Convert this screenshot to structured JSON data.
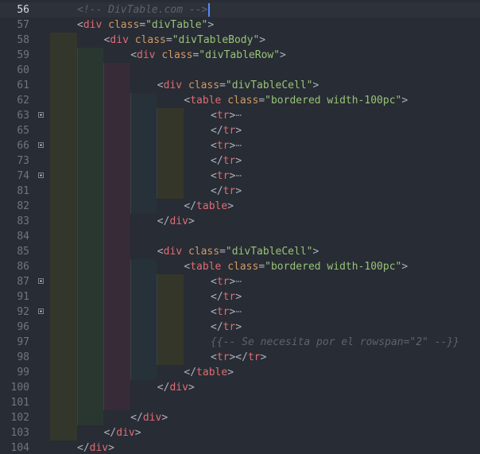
{
  "editor": {
    "active_line": "56",
    "lines": [
      {
        "n": "56",
        "ind": 0,
        "fold": false,
        "tokens": [
          {
            "t": "comment",
            "v": "<!-- DivTable.com -->"
          }
        ]
      },
      {
        "n": "57",
        "ind": 0,
        "fold": false,
        "tokens": [
          {
            "t": "punct",
            "v": "<"
          },
          {
            "t": "tag",
            "v": "div"
          },
          {
            "t": "punct",
            "v": " "
          },
          {
            "t": "attr",
            "v": "class"
          },
          {
            "t": "punct",
            "v": "="
          },
          {
            "t": "str",
            "v": "\"divTable\""
          },
          {
            "t": "punct",
            "v": ">"
          }
        ]
      },
      {
        "n": "58",
        "ind": 1,
        "fold": false,
        "tokens": [
          {
            "t": "punct",
            "v": "<"
          },
          {
            "t": "tag",
            "v": "div"
          },
          {
            "t": "punct",
            "v": " "
          },
          {
            "t": "attr",
            "v": "class"
          },
          {
            "t": "punct",
            "v": "="
          },
          {
            "t": "str",
            "v": "\"divTableBody\""
          },
          {
            "t": "punct",
            "v": ">"
          }
        ]
      },
      {
        "n": "59",
        "ind": 2,
        "fold": false,
        "tokens": [
          {
            "t": "punct",
            "v": "<"
          },
          {
            "t": "tag",
            "v": "div"
          },
          {
            "t": "punct",
            "v": " "
          },
          {
            "t": "attr",
            "v": "class"
          },
          {
            "t": "punct",
            "v": "="
          },
          {
            "t": "str",
            "v": "\"divTableRow\""
          },
          {
            "t": "punct",
            "v": ">"
          }
        ]
      },
      {
        "n": "60",
        "ind": 3,
        "fold": false,
        "tokens": []
      },
      {
        "n": "61",
        "ind": 3,
        "fold": false,
        "tokens": [
          {
            "t": "punct",
            "v": "<"
          },
          {
            "t": "tag",
            "v": "div"
          },
          {
            "t": "punct",
            "v": " "
          },
          {
            "t": "attr",
            "v": "class"
          },
          {
            "t": "punct",
            "v": "="
          },
          {
            "t": "str",
            "v": "\"divTableCell\""
          },
          {
            "t": "punct",
            "v": ">"
          }
        ]
      },
      {
        "n": "62",
        "ind": 4,
        "fold": false,
        "tokens": [
          {
            "t": "punct",
            "v": "<"
          },
          {
            "t": "tag",
            "v": "table"
          },
          {
            "t": "punct",
            "v": " "
          },
          {
            "t": "attr",
            "v": "class"
          },
          {
            "t": "punct",
            "v": "="
          },
          {
            "t": "str",
            "v": "\"bordered width-100pc\""
          },
          {
            "t": "punct",
            "v": ">"
          }
        ]
      },
      {
        "n": "63",
        "ind": 5,
        "fold": true,
        "tokens": [
          {
            "t": "punct",
            "v": "<"
          },
          {
            "t": "tag",
            "v": "tr"
          },
          {
            "t": "punct",
            "v": ">"
          },
          {
            "t": "ellipsis",
            "v": "⋯"
          }
        ]
      },
      {
        "n": "65",
        "ind": 5,
        "fold": false,
        "tokens": [
          {
            "t": "punct",
            "v": "</"
          },
          {
            "t": "tag",
            "v": "tr"
          },
          {
            "t": "punct",
            "v": ">"
          }
        ]
      },
      {
        "n": "66",
        "ind": 5,
        "fold": true,
        "tokens": [
          {
            "t": "punct",
            "v": "<"
          },
          {
            "t": "tag",
            "v": "tr"
          },
          {
            "t": "punct",
            "v": ">"
          },
          {
            "t": "ellipsis",
            "v": "⋯"
          }
        ]
      },
      {
        "n": "73",
        "ind": 5,
        "fold": false,
        "tokens": [
          {
            "t": "punct",
            "v": "</"
          },
          {
            "t": "tag",
            "v": "tr"
          },
          {
            "t": "punct",
            "v": ">"
          }
        ]
      },
      {
        "n": "74",
        "ind": 5,
        "fold": true,
        "tokens": [
          {
            "t": "punct",
            "v": "<"
          },
          {
            "t": "tag",
            "v": "tr"
          },
          {
            "t": "punct",
            "v": ">"
          },
          {
            "t": "ellipsis",
            "v": "⋯"
          }
        ]
      },
      {
        "n": "81",
        "ind": 5,
        "fold": false,
        "tokens": [
          {
            "t": "punct",
            "v": "</"
          },
          {
            "t": "tag",
            "v": "tr"
          },
          {
            "t": "punct",
            "v": ">"
          }
        ]
      },
      {
        "n": "82",
        "ind": 4,
        "fold": false,
        "tokens": [
          {
            "t": "punct",
            "v": "</"
          },
          {
            "t": "tag",
            "v": "table"
          },
          {
            "t": "punct",
            "v": ">"
          }
        ]
      },
      {
        "n": "83",
        "ind": 3,
        "fold": false,
        "tokens": [
          {
            "t": "punct",
            "v": "</"
          },
          {
            "t": "tag",
            "v": "div"
          },
          {
            "t": "punct",
            "v": ">"
          }
        ]
      },
      {
        "n": "84",
        "ind": 3,
        "fold": false,
        "tokens": []
      },
      {
        "n": "85",
        "ind": 3,
        "fold": false,
        "tokens": [
          {
            "t": "punct",
            "v": "<"
          },
          {
            "t": "tag",
            "v": "div"
          },
          {
            "t": "punct",
            "v": " "
          },
          {
            "t": "attr",
            "v": "class"
          },
          {
            "t": "punct",
            "v": "="
          },
          {
            "t": "str",
            "v": "\"divTableCell\""
          },
          {
            "t": "punct",
            "v": ">"
          }
        ]
      },
      {
        "n": "86",
        "ind": 4,
        "fold": false,
        "tokens": [
          {
            "t": "punct",
            "v": "<"
          },
          {
            "t": "tag",
            "v": "table"
          },
          {
            "t": "punct",
            "v": " "
          },
          {
            "t": "attr",
            "v": "class"
          },
          {
            "t": "punct",
            "v": "="
          },
          {
            "t": "str",
            "v": "\"bordered width-100pc\""
          },
          {
            "t": "punct",
            "v": ">"
          }
        ]
      },
      {
        "n": "87",
        "ind": 5,
        "fold": true,
        "tokens": [
          {
            "t": "punct",
            "v": "<"
          },
          {
            "t": "tag",
            "v": "tr"
          },
          {
            "t": "punct",
            "v": ">"
          },
          {
            "t": "ellipsis",
            "v": "⋯"
          }
        ]
      },
      {
        "n": "91",
        "ind": 5,
        "fold": false,
        "tokens": [
          {
            "t": "punct",
            "v": "</"
          },
          {
            "t": "tag",
            "v": "tr"
          },
          {
            "t": "punct",
            "v": ">"
          }
        ]
      },
      {
        "n": "92",
        "ind": 5,
        "fold": true,
        "tokens": [
          {
            "t": "punct",
            "v": "<"
          },
          {
            "t": "tag",
            "v": "tr"
          },
          {
            "t": "punct",
            "v": ">"
          },
          {
            "t": "ellipsis",
            "v": "⋯"
          }
        ]
      },
      {
        "n": "96",
        "ind": 5,
        "fold": false,
        "tokens": [
          {
            "t": "punct",
            "v": "</"
          },
          {
            "t": "tag",
            "v": "tr"
          },
          {
            "t": "punct",
            "v": ">"
          }
        ]
      },
      {
        "n": "97",
        "ind": 5,
        "fold": false,
        "tokens": [
          {
            "t": "comment",
            "v": "{{-- Se necesita por el rowspan=\"2\" --}}"
          }
        ]
      },
      {
        "n": "98",
        "ind": 5,
        "fold": false,
        "tokens": [
          {
            "t": "punct",
            "v": "<"
          },
          {
            "t": "tag",
            "v": "tr"
          },
          {
            "t": "punct",
            "v": "></"
          },
          {
            "t": "tag",
            "v": "tr"
          },
          {
            "t": "punct",
            "v": ">"
          }
        ]
      },
      {
        "n": "99",
        "ind": 4,
        "fold": false,
        "tokens": [
          {
            "t": "punct",
            "v": "</"
          },
          {
            "t": "tag",
            "v": "table"
          },
          {
            "t": "punct",
            "v": ">"
          }
        ]
      },
      {
        "n": "100",
        "ind": 3,
        "fold": false,
        "tokens": [
          {
            "t": "punct",
            "v": "</"
          },
          {
            "t": "tag",
            "v": "div"
          },
          {
            "t": "punct",
            "v": ">"
          }
        ]
      },
      {
        "n": "101",
        "ind": 3,
        "fold": false,
        "tokens": []
      },
      {
        "n": "102",
        "ind": 2,
        "fold": false,
        "tokens": [
          {
            "t": "punct",
            "v": "</"
          },
          {
            "t": "tag",
            "v": "div"
          },
          {
            "t": "punct",
            "v": ">"
          }
        ]
      },
      {
        "n": "103",
        "ind": 1,
        "fold": false,
        "tokens": [
          {
            "t": "punct",
            "v": "</"
          },
          {
            "t": "tag",
            "v": "div"
          },
          {
            "t": "punct",
            "v": ">"
          }
        ]
      },
      {
        "n": "104",
        "ind": 0,
        "fold": false,
        "tokens": [
          {
            "t": "punct",
            "v": "</"
          },
          {
            "t": "tag",
            "v": "div"
          },
          {
            "t": "punct",
            "v": ">"
          }
        ]
      }
    ]
  }
}
